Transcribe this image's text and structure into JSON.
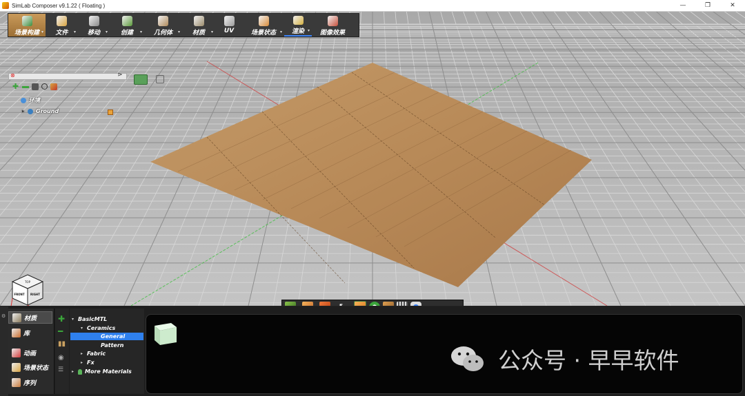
{
  "window": {
    "title": "SimLab Composer v9.1.22 ( Floating )",
    "controls": [
      "—",
      "❐",
      "✕"
    ]
  },
  "toolbar": {
    "items": [
      {
        "label": "场景构建",
        "icon": "scene-build-icon",
        "active": true,
        "caret": true,
        "color": "#3c8d3c"
      },
      {
        "label": "文件",
        "icon": "file-icon",
        "caret": true,
        "color": "#d9a441"
      },
      {
        "label": "移动",
        "icon": "move-icon",
        "caret": true,
        "color": "#8a8a8a"
      },
      {
        "label": "创建",
        "icon": "create-icon",
        "caret": true,
        "color": "#5a9a3a"
      },
      {
        "label": "几何体",
        "icon": "geometry-icon",
        "caret": true,
        "color": "#b08a5a"
      },
      {
        "label": "材质",
        "icon": "material-icon",
        "caret": true,
        "color": "#9a8a6a"
      },
      {
        "label": "UV",
        "icon": "uv-icon",
        "caret": false,
        "color": "#9a9a9a"
      },
      {
        "label": "场景状态",
        "icon": "scene-state-icon",
        "caret": true,
        "color": "#d98c3a"
      },
      {
        "label": "渲染",
        "icon": "render-icon",
        "caret": true,
        "color": "#d4b040"
      },
      {
        "label": "图像效果",
        "icon": "image-effects-icon",
        "caret": false,
        "color": "#c8503c"
      }
    ]
  },
  "scene_tree": {
    "search_placeholder": "",
    "items": [
      {
        "label": "环境",
        "icon": "environment-icon"
      },
      {
        "label": "Ground",
        "icon": "ground-icon"
      }
    ]
  },
  "viewcube": {
    "front": "FRONT",
    "right": "RIGHT",
    "top": "TOP"
  },
  "bottom_nav": {
    "items": [
      {
        "label": "材质",
        "icon": "material-icon",
        "active": true
      },
      {
        "label": "库",
        "icon": "library-icon"
      },
      {
        "label": "动画",
        "icon": "animation-icon"
      },
      {
        "label": "场景状态",
        "icon": "scene-state-icon"
      },
      {
        "label": "序列",
        "icon": "sequence-icon"
      }
    ]
  },
  "library_tree": {
    "root": "BasicMTL",
    "category": "Ceramics",
    "items": [
      "General",
      "Pattern"
    ],
    "selected": "General",
    "others": [
      "Fabric",
      "Fx",
      "More Materials"
    ]
  },
  "watermark": {
    "text": "公众号 · 早早软件"
  },
  "colors": {
    "accent": "#2f80ed",
    "floor": "#b78a5a",
    "grid_bg": "#b9b9b9"
  }
}
